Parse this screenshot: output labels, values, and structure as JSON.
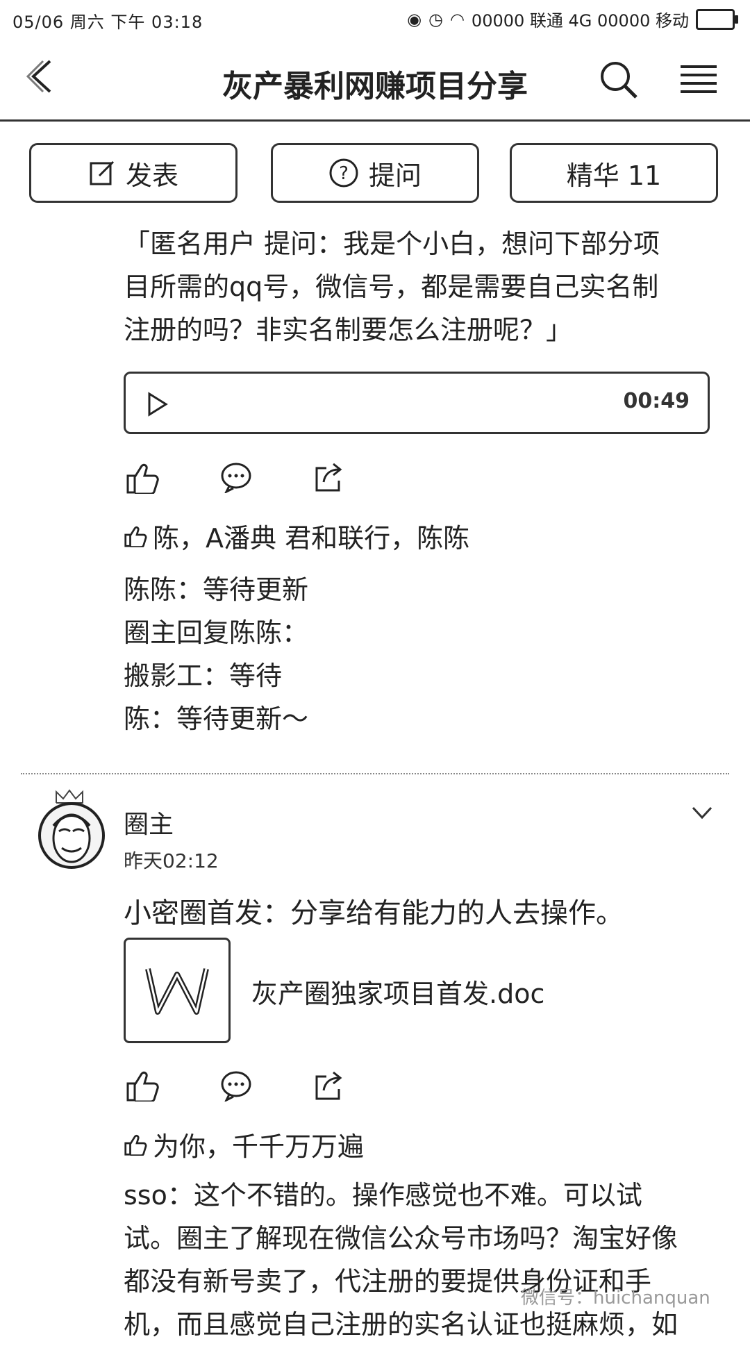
{
  "status_bar": {
    "left_text": "05/06 周六 下午 03:18",
    "right_text": "00000 联通 4G 00000 移动"
  },
  "header": {
    "title": "灰产暴利网赚项目分享"
  },
  "actions": {
    "post_label": "发表",
    "ask_label": "提问",
    "essence_label": "精华 11"
  },
  "post1": {
    "lines": [
      "「匿名用户  提问：我是个小白，想问下部分项",
      "目所需的qq号，微信号，都是需要自己实名制",
      "注册的吗？非实名制要怎么注册呢？」"
    ],
    "audio_duration": "00:49",
    "likes": "陈，A潘典 君和联行，陈陈",
    "comments": [
      "陈陈：等待更新",
      "圈主回复陈陈：",
      "搬影工：等待",
      "陈：等待更新～"
    ]
  },
  "post2": {
    "author": "圈主",
    "time": "昨天02:12",
    "text": "小密圈首发：分享给有能力的人去操作。",
    "doc_name": "灰产圈独家项目首发.doc",
    "likes": "为你，千千万万遍",
    "comment_lines": [
      "sso：这个不错的。操作感觉也不难。可以试",
      "试。圈主了解现在微信公众号市场吗？淘宝好像",
      "都没有新号卖了，代注册的要提供身份证和手",
      "机，而且感觉自己注册的实名认证也挺麻烦，如"
    ]
  },
  "watermark": "微信号：huichanquan"
}
